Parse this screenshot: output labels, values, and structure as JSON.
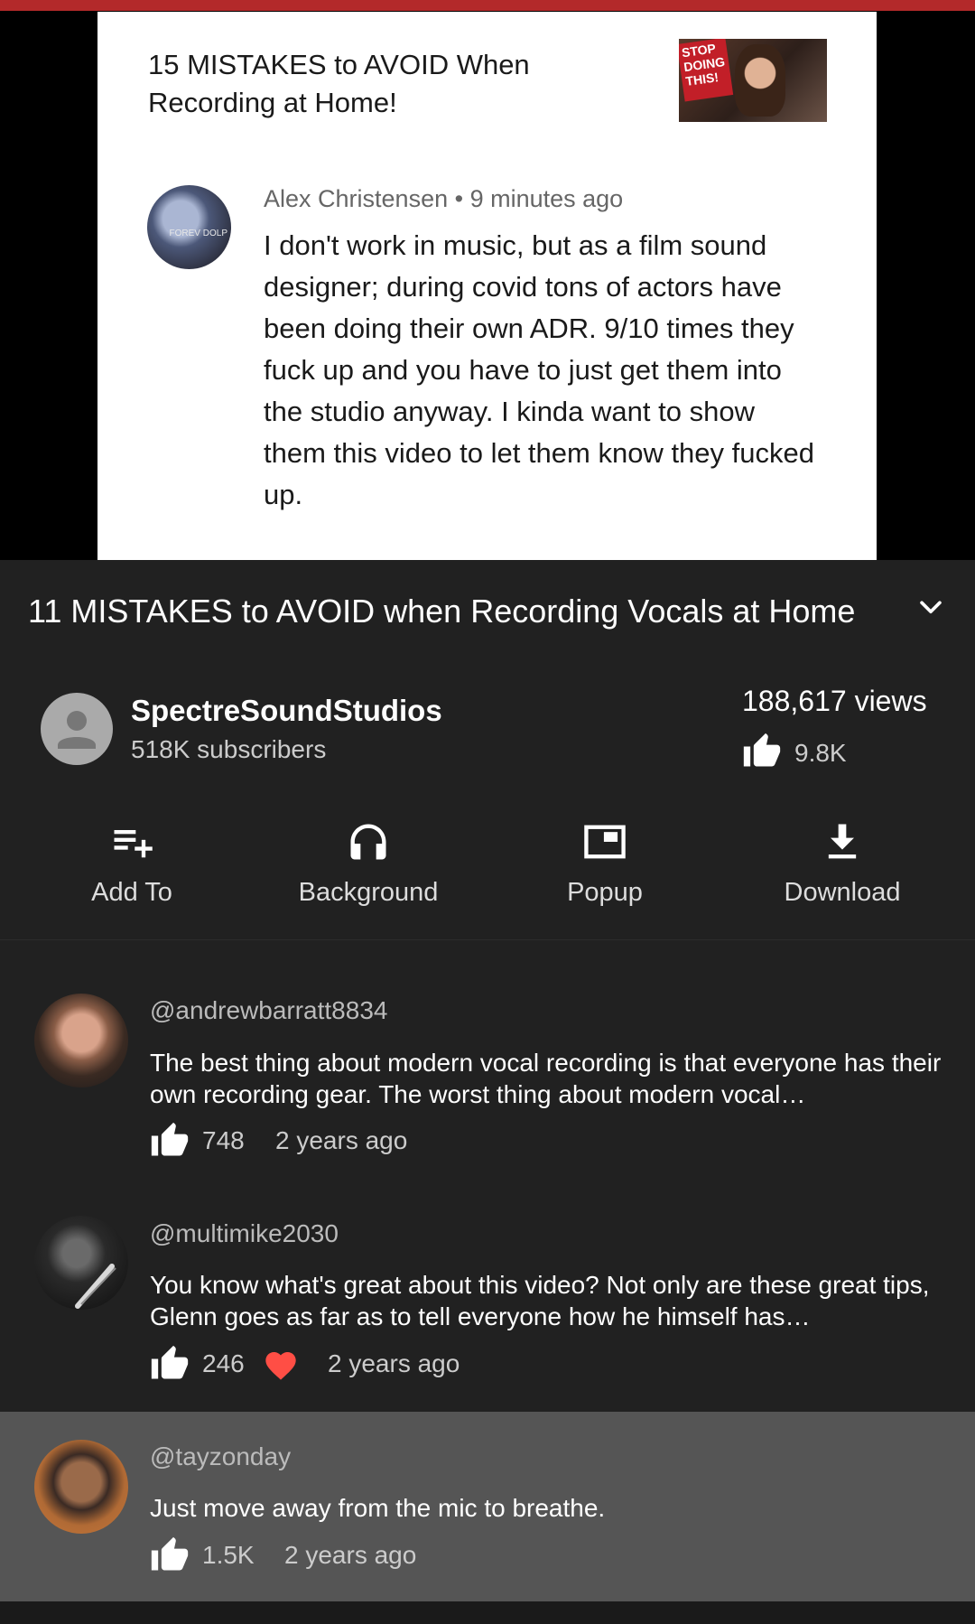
{
  "embedded_comment": {
    "video_title": "15 MISTAKES to AVOID When Recording at Home!",
    "thumbnail_text": "STOP DOING THIS!",
    "avatar_text": "FOREV DOLP",
    "author": "Alex Christensen",
    "separator": "•",
    "time": "9 minutes ago",
    "text": "I don't work in music, but as a film sound designer; during covid tons of actors have been doing their own ADR. 9/10 times they fuck up and you have to just get them into the studio anyway. I kinda want to show them this video to let them know they fucked up."
  },
  "video": {
    "title": "11 MISTAKES to AVOID when Recording Vocals at Home",
    "views": "188,617 views",
    "likes": "9.8K"
  },
  "channel": {
    "name": "SpectreSoundStudios",
    "subscribers": "518K subscribers"
  },
  "actions": [
    {
      "label": "Add To",
      "icon": "playlist-add-icon"
    },
    {
      "label": "Background",
      "icon": "headphones-icon"
    },
    {
      "label": "Popup",
      "icon": "popup-icon"
    },
    {
      "label": "Download",
      "icon": "download-icon"
    }
  ],
  "comments": [
    {
      "handle": "@andrewbarratt8834",
      "text": "The best thing about modern vocal recording is that everyone has their own recording gear.  The worst thing about modern vocal…",
      "likes": "748",
      "time": "2 years ago",
      "hearted": false
    },
    {
      "handle": "@multimike2030",
      "text": "You know what's great about this video? Not only are these great tips, Glenn goes as far as to tell everyone how he himself has…",
      "likes": "246",
      "time": "2 years ago",
      "hearted": true
    },
    {
      "handle": "@tayzonday",
      "text": "Just move away from the mic to breathe.",
      "likes": "1.5K",
      "time": "2 years ago",
      "hearted": false
    }
  ],
  "colors": {
    "background": "#212121",
    "top_accent": "#b3292a",
    "heart": "#ff4e45",
    "highlight_row": "#555555"
  }
}
